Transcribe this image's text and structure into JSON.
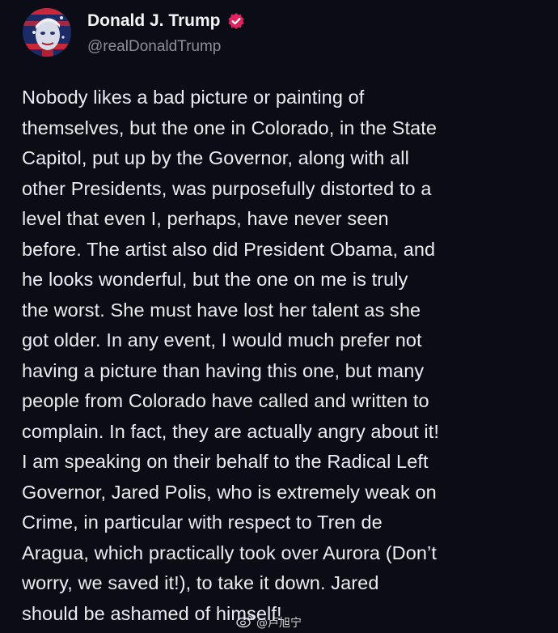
{
  "post": {
    "display_name": "Donald J. Trump",
    "handle": "@realDonaldTrump",
    "verified": true,
    "accent_color": "#e0245e",
    "lines": [
      "Nobody likes a bad picture or painting of",
      "themselves, but the one in Colorado, in the State",
      "Capitol, put up by the Governor, along with all",
      "other Presidents, was purposefully distorted to a",
      "level that even I, perhaps, have never seen",
      "before. The artist also did President Obama, and",
      "he looks wonderful, but the one on me is truly",
      "the worst. She must have lost her talent as she",
      "got older. In any event, I would much prefer not",
      "having a picture than having this one, but many",
      "people from Colorado have called and written to",
      "complain. In fact, they are actually angry about it!",
      "I am speaking on their behalf to the Radical Left",
      "Governor, Jared Polis, who is extremely weak on",
      "Crime, in particular with respect to Tren de",
      "Aragua, which practically took over Aurora (Don’t",
      "worry, we saved it!), to take it down. Jared",
      "should be ashamed of himself!"
    ]
  },
  "watermark": {
    "icon": "weibo-icon",
    "text": "@卢旭宁"
  }
}
